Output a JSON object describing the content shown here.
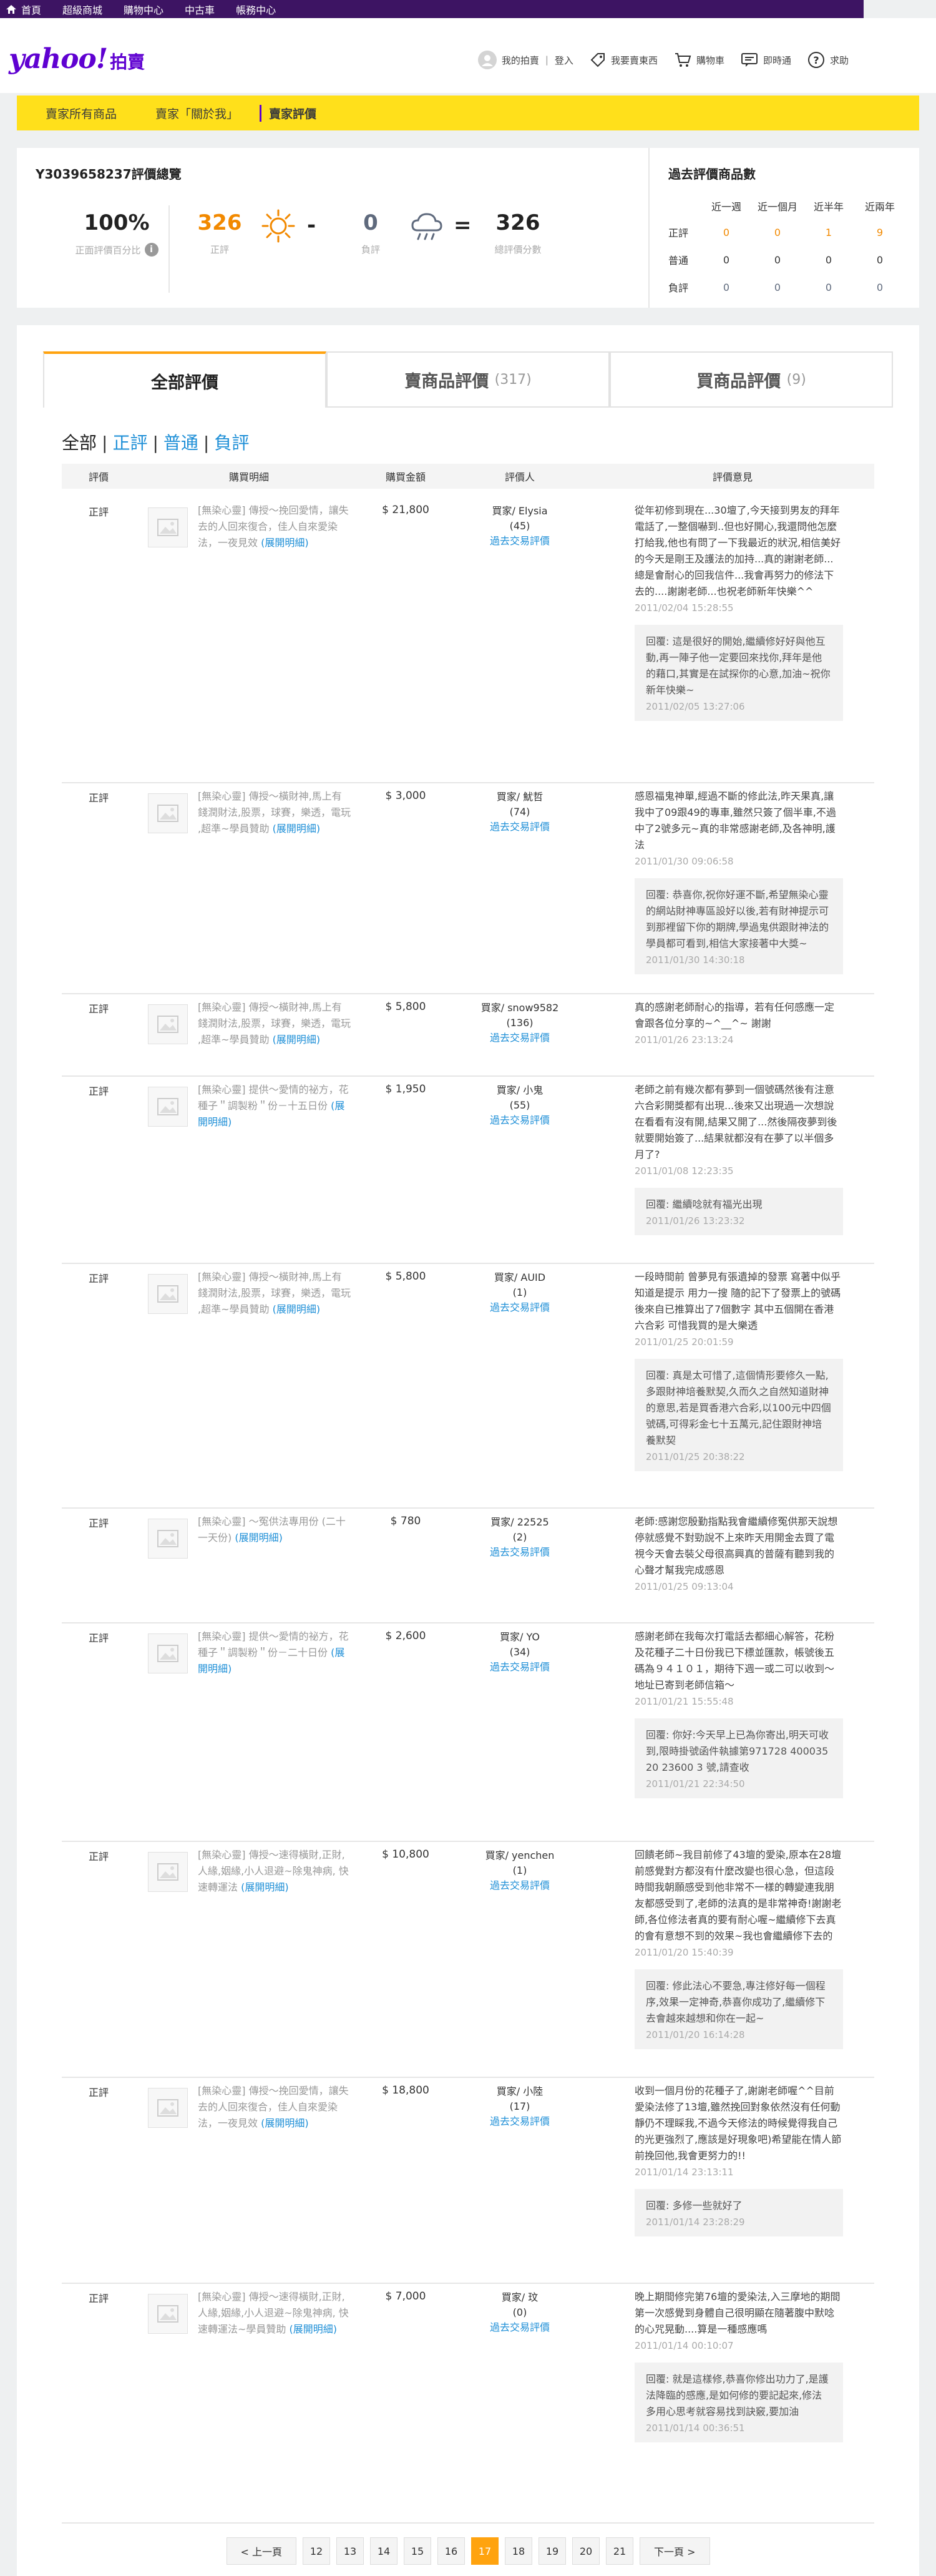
{
  "topbar": {
    "items": [
      "首頁",
      "超級商城",
      "購物中心",
      "中古車",
      "帳務中心"
    ]
  },
  "header": {
    "logo_text": "yahoo!",
    "logo_sub": "拍賣",
    "my_auction": "我的拍賣",
    "login": "登入",
    "sell": "我要賣東西",
    "cart": "購物車",
    "chat": "即時通",
    "help": "求助",
    "sep": "|"
  },
  "seller_tabs": {
    "all_items": "賣家所有商品",
    "about": "賣家「關於我」",
    "rating": "賣家評價"
  },
  "summary": {
    "title": "Y3039658237評價總覽",
    "percent": "100%",
    "percent_label": "正面評價百分比",
    "info": "i",
    "positive": "326",
    "positive_label": "正評",
    "minus": "-",
    "negative": "0",
    "negative_label": "負評",
    "equals": "=",
    "total": "326",
    "total_label": "總評價分數"
  },
  "past": {
    "title": "過去評價商品數",
    "headers": [
      "近一週",
      "近一個月",
      "近半年",
      "近兩年"
    ],
    "rows": [
      {
        "label": "正評",
        "values": [
          "0",
          "0",
          "1",
          "9"
        ]
      },
      {
        "label": "普通",
        "values": [
          "0",
          "0",
          "0",
          "0"
        ]
      },
      {
        "label": "負評",
        "values": [
          "0",
          "0",
          "0",
          "0"
        ]
      }
    ]
  },
  "tabs": {
    "all": "全部評價",
    "seller": "賣商品評價",
    "seller_count": "(317)",
    "buyer": "買商品評價",
    "buyer_count": "(9)"
  },
  "filters": {
    "all": "全部",
    "pos": "正評",
    "neu": "普通",
    "neg": "負評",
    "sep": "|"
  },
  "columns": [
    "評價",
    "購買明細",
    "購買金額",
    "評價人",
    "評價意見"
  ],
  "rows": [
    {
      "rate": "正評",
      "item": "[無染心靈] 傳授～挽回愛情，讓失去的人回來復合，佳人自來愛染法，一夜見效",
      "link": "(展開明細)",
      "price": "$ 21,800",
      "buyer": "買家/ Elysia",
      "count": "(45)",
      "hist": "過去交易評價",
      "comment": "從年初修到現在...30壇了,今天接到男友的拜年電話了,一整個嚇到..但也好開心,我還問他怎麼打給我,他也有問了一下我最近的狀況,相信美好的今天是剛王及護法的加持...真的謝謝老師...總是會耐心的回我信件...我會再努力的修法下去的....謝謝老師...也祝老師新年快樂^^",
      "date": "2011/02/04 15:28:55",
      "reply": "回覆: 這是很好的開始,繼續修好好與他互動,再一陣子他一定要回來找你,拜年是他的藉口,其實是在試探你的心意,加油~祝你新年快樂~",
      "reply_date": "2011/02/05 13:27:06"
    },
    {
      "rate": "正評",
      "item": "[無染心靈] 傳授～橫財神,馬上有錢潤財法,股票，球賽，樂透，電玩 ,超準~學員贊助",
      "link": "(展開明細)",
      "price": "$ 3,000",
      "buyer": "買家/ 魷哲",
      "count": "(74)",
      "hist": "過去交易評價",
      "comment": "感恩福鬼神單,經過不斷的修此法,昨天果真,讓我中了09跟49的專車,雖然只簽了個半車,不過中了2號多元~真的非常感謝老師,及各神明,護法",
      "date": "2011/01/30 09:06:58",
      "reply": "回覆: 恭喜你,祝你好運不斷,希望無染心靈的網站財神專區設好以後,若有財神提示可到那裡留下你的期牌,學過鬼供跟財神法的學員都可看到,相信大家接著中大獎~",
      "reply_date": "2011/01/30 14:30:18"
    },
    {
      "rate": "正評",
      "item": "[無染心靈] 傳授～橫財神,馬上有錢潤財法,股票，球賽，樂透，電玩 ,超準~學員贊助",
      "link": "(展開明細)",
      "price": "$ 5,800",
      "buyer": "買家/ snow9582",
      "count": "(136)",
      "hist": "過去交易評價",
      "comment": "真的感謝老師耐心的指導，若有任何感應一定會跟各位分享的~^__^~ 謝謝",
      "date": "2011/01/26 23:13:24",
      "reply": "",
      "reply_date": ""
    },
    {
      "rate": "正評",
      "item": "[無染心靈] 提供～愛情的祕方，花種子＂調製粉＂份－十五日份",
      "link": "(展開明細)",
      "price": "$ 1,950",
      "buyer": "買家/ 小鬼",
      "count": "(55)",
      "hist": "過去交易評價",
      "comment": "老師之前有幾次都有夢到一個號碼然後有注意六合彩開獎都有出現...後來又出現過一次想說在看看有沒有開,結果又開了...然後隔夜夢到後就要開始簽了...結果就都沒有在夢了以半個多月了?",
      "date": "2011/01/08 12:23:35",
      "reply": "回覆: 繼續唸就有福光出現",
      "reply_date": "2011/01/26 13:23:32"
    },
    {
      "rate": "正評",
      "item": "[無染心靈] 傳授～橫財神,馬上有錢潤財法,股票，球賽，樂透，電玩 ,超準~學員贊助",
      "link": "(展開明細)",
      "price": "$ 5,800",
      "buyer": "買家/ AUID",
      "count": "(1)",
      "hist": "過去交易評價",
      "comment": "一段時間前 曾夢見有張遺掉的發票 寫著中似乎知道是提示 用力一搜 隨的記下了發票上的號碼 後來自已推算出了7個數字 其中五個開在香港六合彩 可惜我買的是大樂透",
      "date": "2011/01/25 20:01:59",
      "reply": "回覆: 真是太可惜了,這個情形要修久一點,多跟財神培養默契,久而久之自然知道財神的意思,若是買香港六合彩,以100元中四個號碼,可得彩金七十五萬元,記住跟財神培養默契",
      "reply_date": "2011/01/25 20:38:22"
    },
    {
      "rate": "正評",
      "item": "[無染心靈] ～冤供法專用份 (二十一天份)",
      "link": "(展開明細)",
      "price": "$ 780",
      "buyer": "買家/ 22525",
      "count": "(2)",
      "hist": "過去交易評價",
      "comment": "老師:感謝您殷勤指點我會繼續修冤供那天說想停就感覺不對勁說不上來昨天用開金去買了電視今天會去裝父母很高興真的普薩有聽到我的心聲才幫我完成感恩",
      "date": "2011/01/25 09:13:04",
      "reply": "",
      "reply_date": ""
    },
    {
      "rate": "正評",
      "item": "[無染心靈] 提供～愛情的祕方，花種子＂調製粉＂份－二十日份",
      "link": "(展開明細)",
      "price": "$ 2,600",
      "buyer": "買家/ YO",
      "count": "(34)",
      "hist": "過去交易評價",
      "comment": "感謝老師在我每次打電話去都細心解答，花粉及花種子二十日份我已下標並匯款，帳號後五碼為９４１０１，期待下週一或二可以收到～地址已寄到老師信箱～",
      "date": "2011/01/21 15:55:48",
      "reply": "回覆: 你好:今天早上已為你寄出,明天可收到,限時掛號函件執據第971728 400035 20 23600 3 號,請查收",
      "reply_date": "2011/01/21 22:34:50"
    },
    {
      "rate": "正評",
      "item": "[無染心靈] 傳授～速得橫財,正財,人緣,姻緣,小人退避~除鬼神病, 快速轉運法",
      "link": "(展開明細)",
      "price": "$ 10,800",
      "buyer": "買家/ yenchen",
      "count": "(1)",
      "hist": "過去交易評價",
      "comment": "回饋老師~我目前修了43壇的愛染,原本在28壇前感覺對方都沒有什麼改變也很心急，但這段時間我朝願感受到他非常不一樣的轉變連我朋友都感受到了,老師的法真的是非常神奇!謝謝老師,各位修法者真的要有耐心喔~繼續修下去真的會有意想不到的效果~我也會繼續修下去的",
      "date": "2011/01/20 15:40:39",
      "reply": "回覆: 修此法心不要急,專注修好每一個程序,效果一定神奇,恭喜你成功了,繼續修下去會越來越想和你在一起~",
      "reply_date": "2011/01/20 16:14:28"
    },
    {
      "rate": "正評",
      "item": "[無染心靈] 傳授～挽回愛情，讓失去的人回來復合，佳人自來愛染法，一夜見效",
      "link": "(展開明細)",
      "price": "$ 18,800",
      "buyer": "買家/ 小陸",
      "count": "(17)",
      "hist": "過去交易評價",
      "comment": "收到一個月份的花種子了,謝謝老師喔^^目前愛染法修了13壇,雖然挽回對象依然沒有任何動靜仍不理睬我,不過今天修法的時候覺得我自己的光更強烈了,應該是好現象吧)希望能在情人節前挽回他,我會更努力的!!",
      "date": "2011/01/14 23:13:11",
      "reply": "回覆: 多修一些就好了",
      "reply_date": "2011/01/14 23:28:29"
    },
    {
      "rate": "正評",
      "item": "[無染心靈] 傳授～速得橫財,正財,人緣,姻緣,小人退避~除鬼神病, 快速轉運法~學員贊助",
      "link": "(展開明細)",
      "price": "$ 7,000",
      "buyer": "買家/ 玟",
      "count": "(0)",
      "hist": "過去交易評價",
      "comment": "晚上期間修完第76壇的愛染法,入三摩地的期間第一次感覺到身體自己很明顯在隨著腹中默唸的心咒晃動....算是一種感應嗎",
      "date": "2011/01/14 00:10:07",
      "reply": "回覆: 就是這樣修,恭喜你修出功力了,是護法降臨的感應,是如何修的要記起來,修法多用心思考就容易找到訣竅,要加油",
      "reply_date": "2011/01/14 00:36:51"
    }
  ],
  "pager": {
    "prev": "< 上一頁",
    "pages": [
      "12",
      "13",
      "14",
      "15",
      "16",
      "17",
      "18",
      "19",
      "20",
      "21"
    ],
    "current": "17",
    "next": "下一頁 >"
  },
  "colors": {
    "purple": "#3d1463",
    "brand": "#5f01d1",
    "yellow": "#ffe01b",
    "orange": "#f28900",
    "link": "#1e8fd7"
  }
}
